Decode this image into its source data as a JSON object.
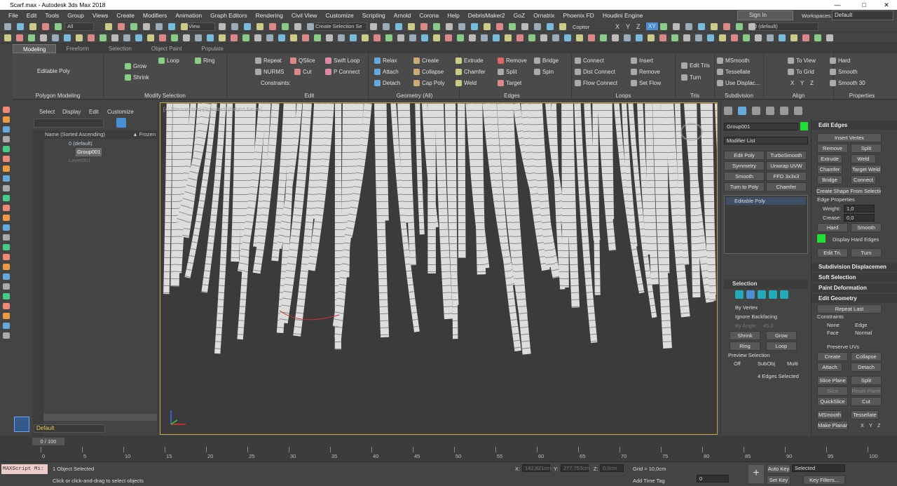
{
  "window": {
    "title": "Scarf.max - Autodesk 3ds Max 2018",
    "min": "—",
    "max": "□",
    "close": "✕"
  },
  "menu": [
    "File",
    "Edit",
    "Tools",
    "Group",
    "Views",
    "Create",
    "Modifiers",
    "Animation",
    "Graph Editors",
    "Rendering",
    "Civil View",
    "Customize",
    "Scripting",
    "Arnold",
    "Corona",
    "Help",
    "DebrisMaker2",
    "GoZ",
    "Ornatrix",
    "Phoenix FD",
    "Houdini Engine"
  ],
  "account": {
    "sign_in": "Sign In",
    "workspaces_label": "Workspaces:",
    "workspace": "Default"
  },
  "toolbar": {
    "selection_filter": "All",
    "ref_coord": "View",
    "selection_set": "Create Selection Se",
    "copitor": "Copitor",
    "axes": [
      "X",
      "Y",
      "Z",
      "XY"
    ],
    "layer": "0 (default)"
  },
  "ribbon": {
    "tabs": [
      "Modeling",
      "Freeform",
      "Selection",
      "Object Paint",
      "Populate"
    ],
    "groups": [
      "Polygon Modeling",
      "Modify Selection",
      "Edit",
      "Geometry (All)",
      "Edges",
      "Loops",
      "Tris",
      "Subdivision",
      "Align",
      "Properties"
    ],
    "polygon_modeling": {
      "editable_poly": "Editable Poly"
    },
    "modify_selection": {
      "grow": "Grow",
      "shrink": "Shrink",
      "loop": "Loop",
      "ring": "Ring"
    },
    "edit": {
      "repeat": "Repeat",
      "qslice": "QSlice",
      "swift_loop": "Swift Loop",
      "nurms": "NURMS",
      "cut": "Cut",
      "p_connect": "P Connect",
      "constraints": "Constraints:"
    },
    "geometry": {
      "relax": "Relax",
      "create": "Create",
      "attach": "Attach",
      "collapse": "Collapse",
      "detach": "Detach",
      "cap_poly": "Cap Poly"
    },
    "edges": {
      "extrude": "Extrude",
      "remove": "Remove",
      "bridge": "Bridge",
      "chamfer": "Chamfer",
      "split": "Split",
      "spin": "Spin",
      "weld": "Weld",
      "target": "Target"
    },
    "loops": {
      "connect": "Connect",
      "insert": "Insert",
      "dist_connect": "Dist Connect",
      "remove": "Remove",
      "flow_connect": "Flow Connect",
      "set_flow": "Set Flow"
    },
    "tris": {
      "edit_tris": "Edit Tris",
      "turn": "Turn"
    },
    "subdivision": {
      "msmooth": "MSmooth",
      "tessellate": "Tessellate",
      "use_displac": "Use Displac..."
    },
    "make_planar": "Make Planar",
    "align": {
      "to_view": "To View",
      "to_grid": "To Grid",
      "xyz": [
        "X",
        "Y",
        "Z"
      ]
    },
    "properties": {
      "hard": "Hard",
      "smooth": "Smooth",
      "smooth30": "Smooth 30"
    }
  },
  "scene_explorer": {
    "menu": [
      "Select",
      "Display",
      "Edit",
      "Customize"
    ],
    "col_name": "Name (Sorted Ascending)",
    "col_frozen": "▲ Frozen",
    "rows": [
      "0 (default)",
      "Group001",
      "Layer001"
    ],
    "layer_name": "Default"
  },
  "viewport": {
    "label": "[+] [Perspective] [Standard] [Edged Faces]"
  },
  "command_panel": {
    "object_name": "Group001",
    "modifier_list": "Modifier List",
    "modifiers": [
      "Edit Poly",
      "TurboSmooth",
      "Symmetry",
      "Unwrap UVW",
      "Smooth",
      "FFD 3x3x3",
      "Turn to Poly",
      "Chamfer"
    ],
    "stack_item": "Editable Poly",
    "selection": {
      "title": "Selection",
      "by_vertex": "By Vertex",
      "ignore_backfacing": "Ignore Backfacing",
      "by_angle": "By Angle:",
      "angle": "45,0",
      "shrink": "Shrink",
      "grow": "Grow",
      "ring": "Ring",
      "loop": "Loop",
      "preview": "Preview Selection",
      "off": "Off",
      "subobj": "SubObj",
      "multi": "Multi",
      "status": "4 Edges Selected"
    }
  },
  "rollout": {
    "edit_edges": "Edit Edges",
    "insert_vertex": "Insert Vertex",
    "remove": "Remove",
    "split": "Split",
    "extrude": "Extrude",
    "weld": "Weld",
    "chamfer": "Chamfer",
    "target_weld": "Target Weld",
    "bridge": "Bridge",
    "connect": "Connect",
    "create_shape": "Create Shape From Selection",
    "edge_props": "Edge Properties",
    "weight_l": "Weight:",
    "weight": "1,0",
    "crease_l": "Crease:",
    "crease": "0,0",
    "hard": "Hard",
    "smooth": "Smooth",
    "display_hard": "Display Hard Edges",
    "edit_tri": "Edit Tri.",
    "turn": "Turn",
    "subdiv_disp": "Subdivision Displacemen",
    "soft_sel": "Soft Selection",
    "paint_deform": "Paint Deformation",
    "edit_geom": "Edit Geometry",
    "repeat_last": "Repeat Last",
    "constraints": "Constraints",
    "none": "None",
    "edge": "Edge",
    "face": "Face",
    "normal": "Normal",
    "preserve_uvs": "Preserve UVs",
    "create": "Create",
    "collapse": "Collapse",
    "attach": "Attach",
    "detach": "Detach",
    "slice_plane": "Slice Plane",
    "split2": "Split",
    "slice": "Slice",
    "reset_plane": "Reset Plane",
    "quickslice": "QuickSlice",
    "cut": "Cut",
    "msmooth": "MSmooth",
    "tessellate": "Tessellate",
    "make_planar": "Make Planar",
    "x": "X",
    "y": "Y",
    "z": "Z"
  },
  "timeline": {
    "frame": "0 / 100",
    "ticks": [
      "0",
      "5",
      "10",
      "15",
      "20",
      "25",
      "30",
      "35",
      "40",
      "45",
      "50",
      "55",
      "60",
      "65",
      "70",
      "75",
      "80",
      "85",
      "90",
      "95",
      "100"
    ]
  },
  "status": {
    "maxscript": "MAXScript Mi:",
    "selected": "1 Object Selected",
    "prompt": "Click or click-and-drag to select objects",
    "x_l": "X:",
    "x": "142,821cm",
    "y_l": "Y:",
    "y": "277,753cm",
    "z_l": "Z:",
    "z": "0,0cm",
    "grid": "Grid = 10,0cm",
    "add_time_tag": "Add Time Tag",
    "auto_key": "Auto Key",
    "set_key": "Set Key",
    "key_mode": "Selected",
    "key_filters": "Key Filters...",
    "frame": "0"
  },
  "colors": {
    "accent": "#4a8fd6",
    "viewport_border": "#c9a54a",
    "green": "#22dd33"
  }
}
